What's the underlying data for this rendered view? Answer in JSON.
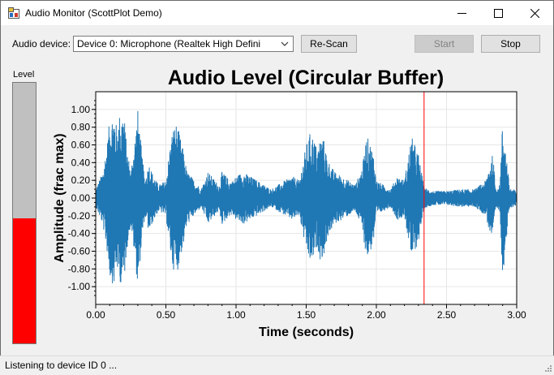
{
  "window": {
    "title": "Audio Monitor (ScottPlot Demo)",
    "icons": {
      "app": "app-icon",
      "minimize": "minimize-icon",
      "maximize": "maximize-icon",
      "close": "close-icon"
    }
  },
  "toolbar": {
    "device_label": "Audio device:",
    "device_selected": "Device 0: Microphone (Realtek High Defini",
    "rescan_label": "Re-Scan",
    "start_label": "Start",
    "start_enabled": false,
    "stop_label": "Stop",
    "dropdown_icon": "chevron-down-icon"
  },
  "level_meter": {
    "label": "Level",
    "level": 0.48,
    "fill_color": "#ff0000",
    "track_color": "#c0c0c0"
  },
  "status": {
    "text": "Listening to device ID 0 ..."
  },
  "chart_data": {
    "type": "line",
    "title": "Audio Level (Circular Buffer)",
    "xlabel": "Time (seconds)",
    "ylabel": "Amplitude (frac max)",
    "xlim": [
      0,
      3.0
    ],
    "ylim": [
      -1.2,
      1.2
    ],
    "x_ticks": [
      0.0,
      0.5,
      1.0,
      1.5,
      2.0,
      2.5,
      3.0
    ],
    "x_tick_labels": [
      "0.00",
      "0.50",
      "1.00",
      "1.50",
      "2.00",
      "2.50",
      "3.00"
    ],
    "y_ticks": [
      1.0,
      0.8,
      0.6,
      0.4,
      0.2,
      0.0,
      -0.2,
      -0.4,
      -0.6,
      -0.8,
      -1.0
    ],
    "y_tick_labels": [
      "1.00",
      "0.80",
      "0.60",
      "0.40",
      "0.20",
      "0.00",
      "-0.20",
      "-0.40",
      "-0.60",
      "-0.80",
      "-1.00"
    ],
    "grid": true,
    "series_color": "#1f77b4",
    "cursor_x": 2.34,
    "cursor_color": "#ff0000",
    "series": [
      {
        "x": [
          0.0,
          0.05,
          0.08,
          0.1,
          0.13,
          0.15,
          0.17,
          0.2,
          0.22,
          0.25,
          0.28,
          0.3,
          0.33,
          0.35,
          0.38,
          0.4,
          0.43,
          0.45,
          0.5,
          0.53,
          0.55,
          0.58,
          0.6,
          0.63,
          0.65,
          0.68,
          0.7,
          0.73,
          0.75,
          0.8,
          0.85,
          0.88,
          0.9,
          0.93,
          0.95,
          0.98,
          1.0,
          1.05,
          1.1,
          1.15,
          1.2,
          1.25,
          1.3,
          1.35,
          1.4,
          1.45,
          1.5,
          1.53,
          1.55,
          1.58,
          1.6,
          1.63,
          1.65,
          1.7,
          1.75,
          1.8,
          1.85,
          1.9,
          1.93,
          1.95,
          1.98,
          2.0,
          2.05,
          2.1,
          2.15,
          2.2,
          2.25,
          2.3,
          2.34,
          2.4,
          2.5,
          2.6,
          2.7,
          2.78,
          2.8,
          2.83,
          2.85,
          2.88,
          2.9,
          2.95,
          3.0
        ],
        "amp": [
          0.1,
          0.3,
          0.6,
          0.9,
          1.0,
          0.8,
          0.95,
          1.0,
          0.6,
          0.3,
          0.7,
          1.0,
          0.5,
          0.2,
          0.4,
          0.3,
          0.2,
          0.15,
          0.2,
          0.6,
          0.8,
          0.85,
          0.7,
          0.5,
          0.3,
          0.25,
          0.2,
          0.15,
          0.1,
          0.3,
          0.2,
          0.15,
          0.3,
          0.25,
          0.2,
          0.2,
          0.25,
          0.3,
          0.25,
          0.2,
          0.15,
          0.1,
          0.15,
          0.2,
          0.25,
          0.2,
          0.6,
          0.75,
          0.7,
          0.55,
          0.7,
          0.65,
          0.45,
          0.3,
          0.25,
          0.2,
          0.15,
          0.35,
          0.7,
          0.65,
          0.5,
          0.2,
          0.15,
          0.1,
          0.25,
          0.2,
          0.7,
          0.5,
          0.12,
          0.08,
          0.08,
          0.1,
          0.1,
          0.2,
          0.35,
          0.5,
          0.12,
          0.15,
          0.9,
          0.12,
          0.08
        ]
      }
    ]
  }
}
